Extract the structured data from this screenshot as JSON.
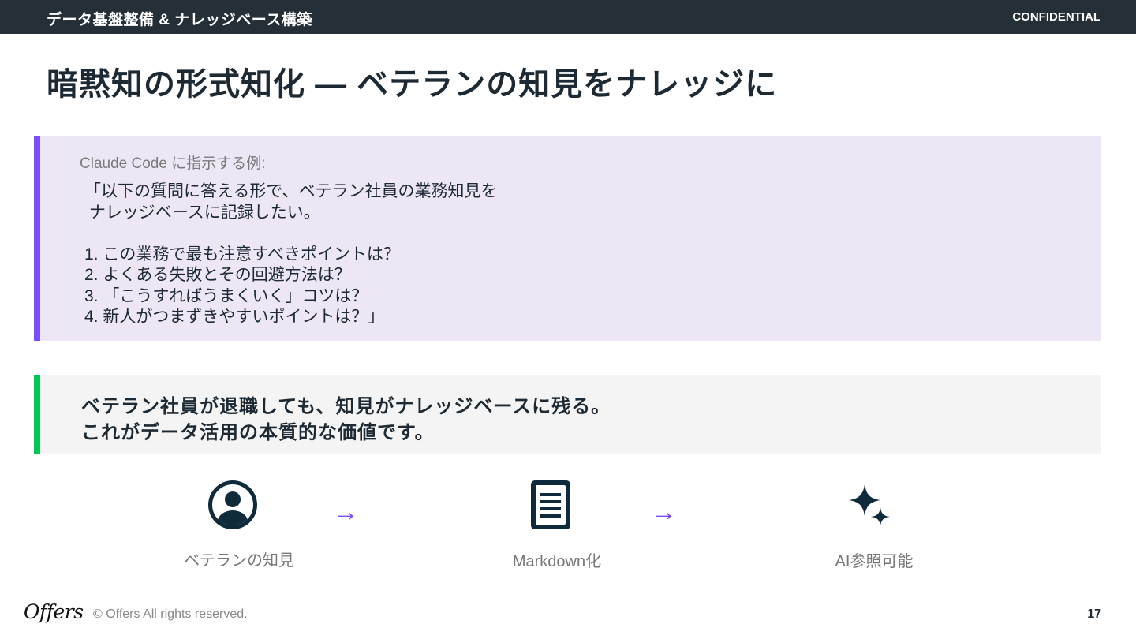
{
  "header": {
    "title": "データ基盤整備 & ナレッジベース構築",
    "confidential": "CONFIDENTIAL"
  },
  "page_title": "暗黙知の形式知化 — ベテランの知見をナレッジに",
  "prompt_box": {
    "caption": "Claude Code に指示する例:",
    "lines": [
      "「以下の質問に答える形で、ベテラン社員の業務知見を",
      " ナレッジベースに記録したい。",
      "",
      "1. この業務で最も注意すべきポイントは？",
      "2. よくある失敗とその回避方法は？",
      "3. 「こうすればうまくいく」コツは？",
      "4. 新人がつまずきやすいポイントは？」"
    ],
    "accent_color": "#7c4dff"
  },
  "highlight": {
    "line1": "ベテラン社員が退職しても、知見がナレッジベースに残る。",
    "line2": "これがデータ活用の本質的な価値です。",
    "accent_color": "#00c853"
  },
  "flow": {
    "steps": [
      {
        "icon": "user-circle-icon",
        "label": "ベテランの知見"
      },
      {
        "icon": "document-icon",
        "label": "Markdown化"
      },
      {
        "icon": "sparkles-icon",
        "label": "AI参照可能"
      }
    ],
    "arrow": "→"
  },
  "footer": {
    "logo": "Offers",
    "copyright": "© Offers All rights reserved.",
    "page_number": "17"
  }
}
